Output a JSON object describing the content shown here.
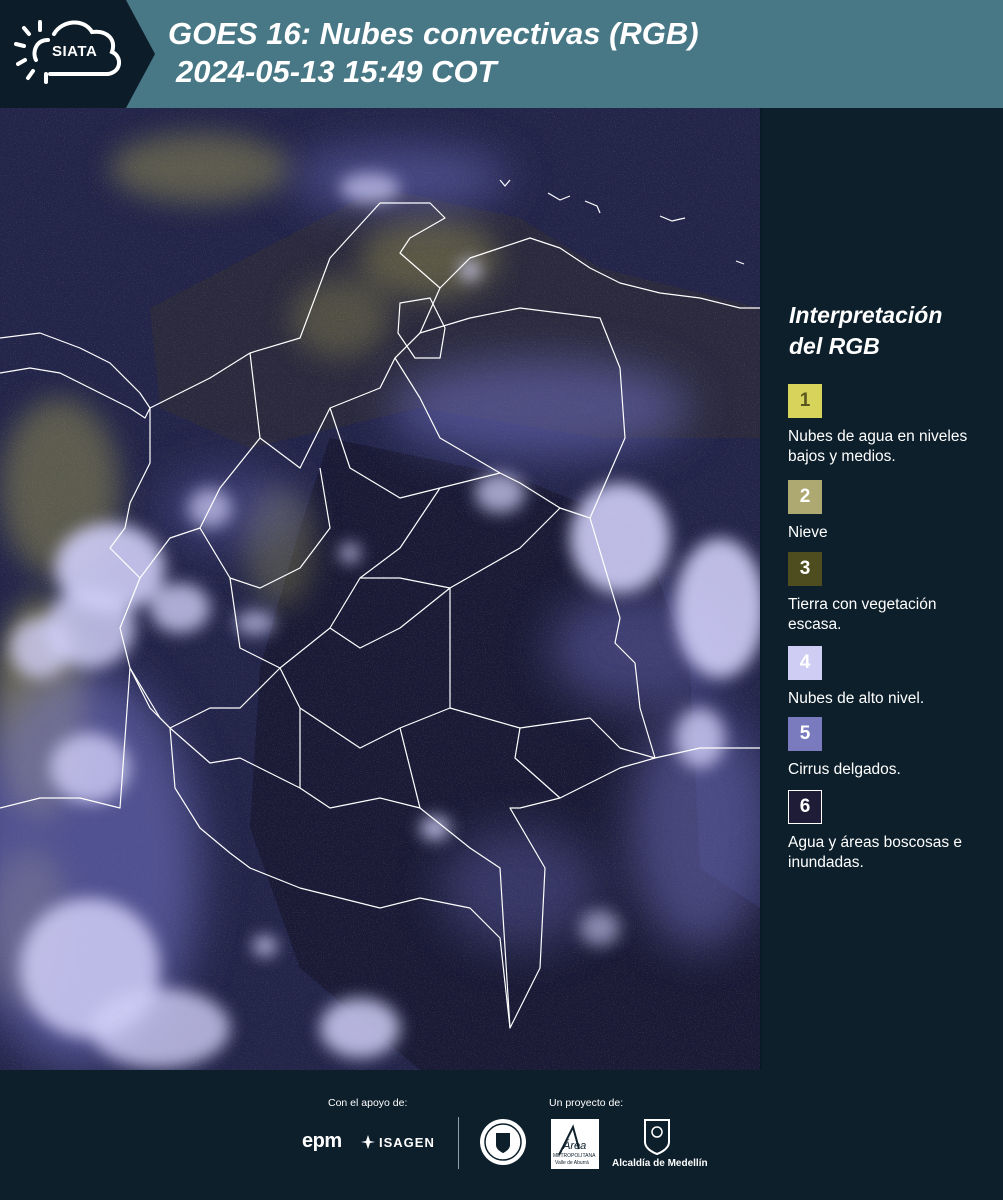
{
  "header": {
    "logo_text": "SIATA",
    "title_line1": "GOES 16: Nubes convectivas (RGB)",
    "title_line2": "2024-05-13 15:49 COT"
  },
  "map": {
    "imagery": "GOES-16 convective clouds RGB satellite image over Colombia with administrative boundary overlay"
  },
  "legend": {
    "title_line1": "Interpretación",
    "title_line2": "del RGB",
    "items": [
      {
        "number": "1",
        "label": "Nubes de agua en niveles bajos y medios.",
        "color": "#d8d35a",
        "text_color": "#5a5620"
      },
      {
        "number": "2",
        "label": "Nieve",
        "color": "#aea871",
        "text_color": "#ffffff"
      },
      {
        "number": "3",
        "label": "Tierra con vegetación escasa.",
        "color": "#4e4d1f",
        "text_color": "#ffffff"
      },
      {
        "number": "4",
        "label": "Nubes de alto nivel.",
        "color": "#cfcdf3",
        "text_color": "#ffffff"
      },
      {
        "number": "5",
        "label": "Cirrus delgados.",
        "color": "#7a7abf",
        "text_color": "#ffffff"
      },
      {
        "number": "6",
        "label": "Agua y áreas boscosas e inundadas.",
        "color": "#1f1c38",
        "text_color": "#ffffff"
      }
    ]
  },
  "footer": {
    "support_label": "Con el apoyo de:",
    "project_label": "Un proyecto de:",
    "sponsor_epm": "epm",
    "sponsor_isagen": "ISAGEN",
    "partner_area_line1": "Área",
    "partner_area_line2": "METROPOLITANA",
    "partner_area_line3": "Valle de Aburrá",
    "partner_alcaldia": "Alcaldía de Medellín"
  },
  "colors": {
    "header_bg": "#487886",
    "panel_bg": "#0d1f2b",
    "map_base": "#1e2146"
  }
}
